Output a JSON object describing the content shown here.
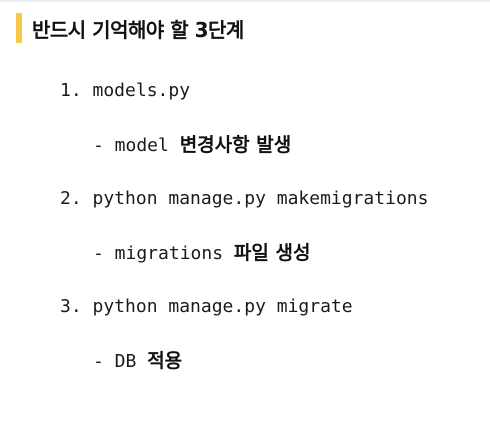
{
  "title": "반드시 기억해야 할 3단계",
  "steps": [
    {
      "command": "1. models.py",
      "detail_prefix": "- model ",
      "detail_ko": "변경사항 발생"
    },
    {
      "command": "2. python manage.py makemigrations",
      "detail_prefix": "- migrations ",
      "detail_ko": "파일 생성"
    },
    {
      "command": "3. python manage.py migrate",
      "detail_prefix": "- DB ",
      "detail_ko": "적용"
    }
  ],
  "colors": {
    "accent_bar": "#f7c948",
    "text": "#1a1a1a"
  }
}
